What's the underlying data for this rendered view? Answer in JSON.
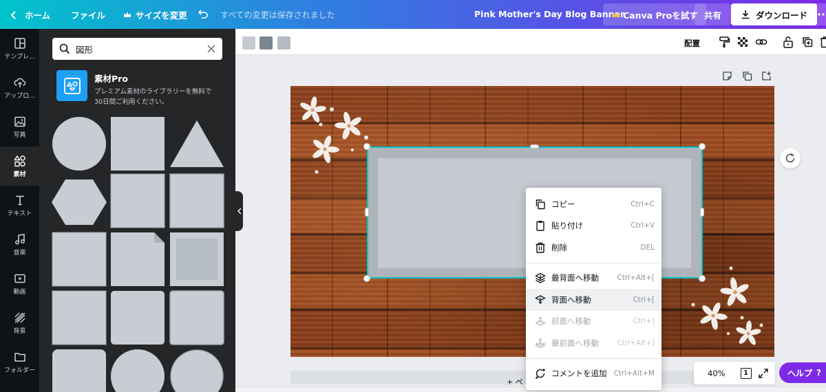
{
  "topbar": {
    "home": "ホーム",
    "file": "ファイル",
    "resize": "サイズを変更",
    "save_status": "すべての変更は保存されました",
    "doc_title": "Pink Mother's Day Blog Banner",
    "pro_trial": "Canva Proを試す",
    "share": "共有",
    "download": "ダウンロード"
  },
  "rail": {
    "items": [
      {
        "label": "テンプレ..."
      },
      {
        "label": "アップロ..."
      },
      {
        "label": "写真"
      },
      {
        "label": "素材"
      },
      {
        "label": "テキスト"
      },
      {
        "label": "音楽"
      },
      {
        "label": "動画"
      },
      {
        "label": "背景"
      },
      {
        "label": "フォルダー"
      }
    ]
  },
  "panel": {
    "search_value": "図形",
    "promo_title": "素材Pro",
    "promo_desc_line1": "プレミアム素材のライブラリーを無料で",
    "promo_desc_line2": "30日間ご利用ください。",
    "shape_color": "#c8cdd4"
  },
  "toolbar": {
    "swatches": [
      "#c5cad1",
      "#7c8692",
      "#b4bbc3"
    ],
    "arrange": "配置"
  },
  "canvas": {
    "add_page": "+ ペ"
  },
  "context_menu": {
    "items": [
      {
        "label": "コピー",
        "shortcut": "Ctrl+C"
      },
      {
        "label": "貼り付け",
        "shortcut": "Ctrl+V"
      },
      {
        "label": "削除",
        "shortcut": "DEL"
      },
      {
        "label": "最背面へ移動",
        "shortcut": "Ctrl+Alt+["
      },
      {
        "label": "背面へ移動",
        "shortcut": "Ctrl+["
      },
      {
        "label": "前面へ移動",
        "shortcut": "Ctrl+]"
      },
      {
        "label": "最前面へ移動",
        "shortcut": "Ctrl+Alt+]"
      },
      {
        "label": "コメントを追加",
        "shortcut": "Ctrl+Alt+M"
      }
    ]
  },
  "zoom": {
    "level": "40%",
    "page_count": "1"
  },
  "help": {
    "label": "ヘルプ",
    "mark": "?"
  },
  "colors": {
    "accent_selection": "#00c4cc",
    "help_purple": "#7d2ae8"
  }
}
